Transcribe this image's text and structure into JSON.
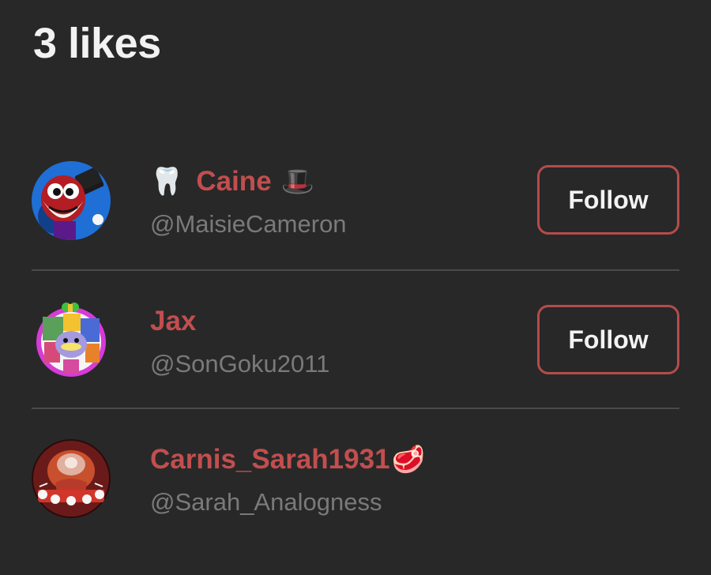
{
  "header": {
    "title": "3 likes"
  },
  "users": [
    {
      "emoji_before": "🦷",
      "name": "Caine",
      "emoji_after": "🎩",
      "handle": "@MaisieCameron",
      "follow_label": "Follow",
      "avatar_icon": "caine-avatar"
    },
    {
      "emoji_before": "",
      "name": "Jax",
      "emoji_after": "",
      "handle": "@SonGoku2011",
      "follow_label": "Follow",
      "avatar_icon": "jax-avatar"
    },
    {
      "emoji_before": "",
      "name": "Carnis_Sarah1931",
      "emoji_after": "🥩",
      "handle": "@Sarah_Analogness",
      "follow_label": "",
      "avatar_icon": "carnis-avatar"
    }
  ],
  "colors": {
    "background": "#282828",
    "title": "#f2f2f2",
    "name": "#c24e4e",
    "handle": "#7a7a7a",
    "button_border": "#b44c4c",
    "divider": "#4a4a4a"
  }
}
